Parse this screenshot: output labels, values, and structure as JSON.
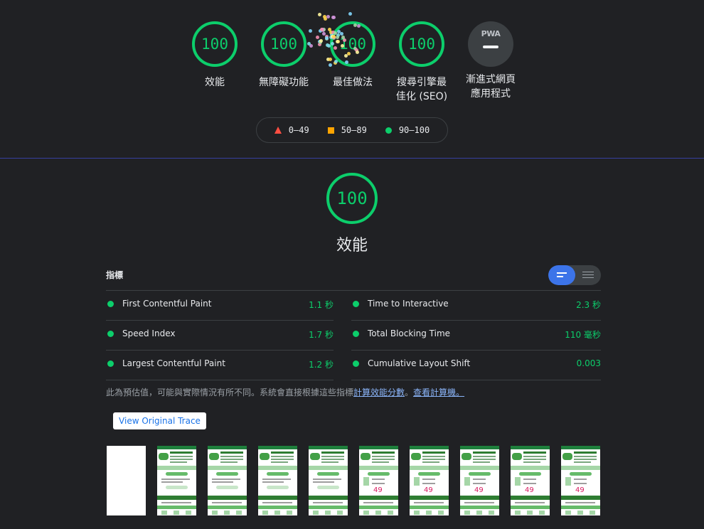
{
  "gauges": [
    {
      "score": "100",
      "label": "效能"
    },
    {
      "score": "100",
      "label": "無障礙功能"
    },
    {
      "score": "100",
      "label": "最佳做法"
    },
    {
      "score": "100",
      "label": "搜尋引擎最\n佳化 (SEO)"
    },
    {
      "score": "",
      "label": "漸進式網頁\n應用程式",
      "badge": "PWA"
    }
  ],
  "legend": [
    {
      "range": "0–49",
      "shape": "triangle",
      "color": "#ff4e42"
    },
    {
      "range": "50–89",
      "shape": "square",
      "color": "#ffa400"
    },
    {
      "range": "90–100",
      "shape": "circle",
      "color": "#0cce6b"
    }
  ],
  "performance": {
    "score": "100",
    "title": "效能"
  },
  "metrics_section": {
    "title": "指標",
    "items": [
      {
        "name": "First Contentful Paint",
        "value": "1.1 秒"
      },
      {
        "name": "Time to Interactive",
        "value": "2.3 秒"
      },
      {
        "name": "Speed Index",
        "value": "1.7 秒"
      },
      {
        "name": "Total Blocking Time",
        "value": "110 毫秒"
      },
      {
        "name": "Largest Contentful Paint",
        "value": "1.2 秒"
      },
      {
        "name": "Cumulative Layout Shift",
        "value": "0.003"
      }
    ]
  },
  "note": {
    "text": "此為預估值，可能與實際情況有所不同。系統會直接根據這些指標",
    "link1": "計算效能分數",
    "sep": "。",
    "link2": "查看計算機。"
  },
  "trace_button": "View Original Trace",
  "filmstrip": {
    "frame_number": "49"
  },
  "colors": {
    "pass": "#0cce6b",
    "average": "#ffa400",
    "fail": "#ff4e42",
    "background": "#202124",
    "accent": "#3c74e9"
  }
}
